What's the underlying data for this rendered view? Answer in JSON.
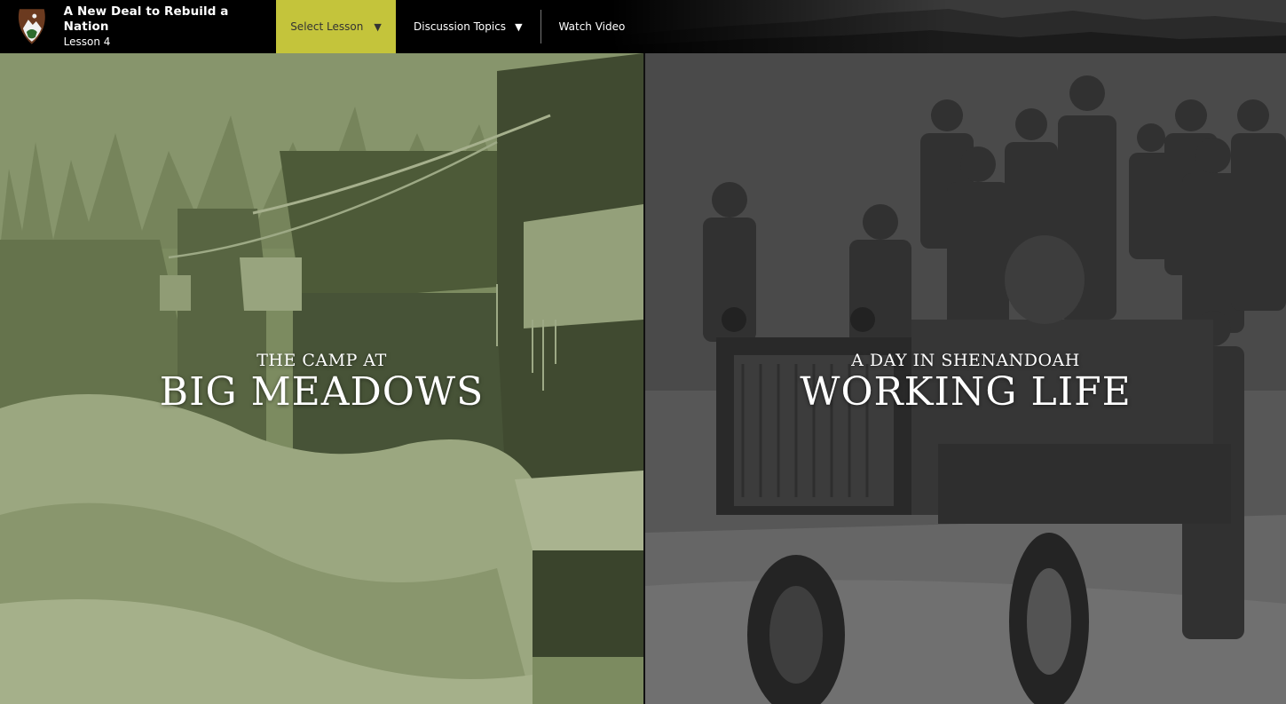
{
  "header": {
    "title": "A New Deal to Rebuild a Nation",
    "subtitle": "Lesson 4",
    "logo_icon": "nps-arrowhead-icon"
  },
  "nav": {
    "select_lesson": "Select Lesson",
    "discussion_topics": "Discussion Topics",
    "watch_video": "Watch Video",
    "caret_icon": "caret-down-icon"
  },
  "panels": {
    "left": {
      "kicker": "THE CAMP AT",
      "title": "BIG MEADOWS"
    },
    "right": {
      "kicker": "A DAY IN SHENANDOAH",
      "title": "WORKING LIFE"
    }
  },
  "colors": {
    "accent": "#c4c43b",
    "left_tint": "#7c8a60",
    "right_tint": "#4d4d4d"
  }
}
